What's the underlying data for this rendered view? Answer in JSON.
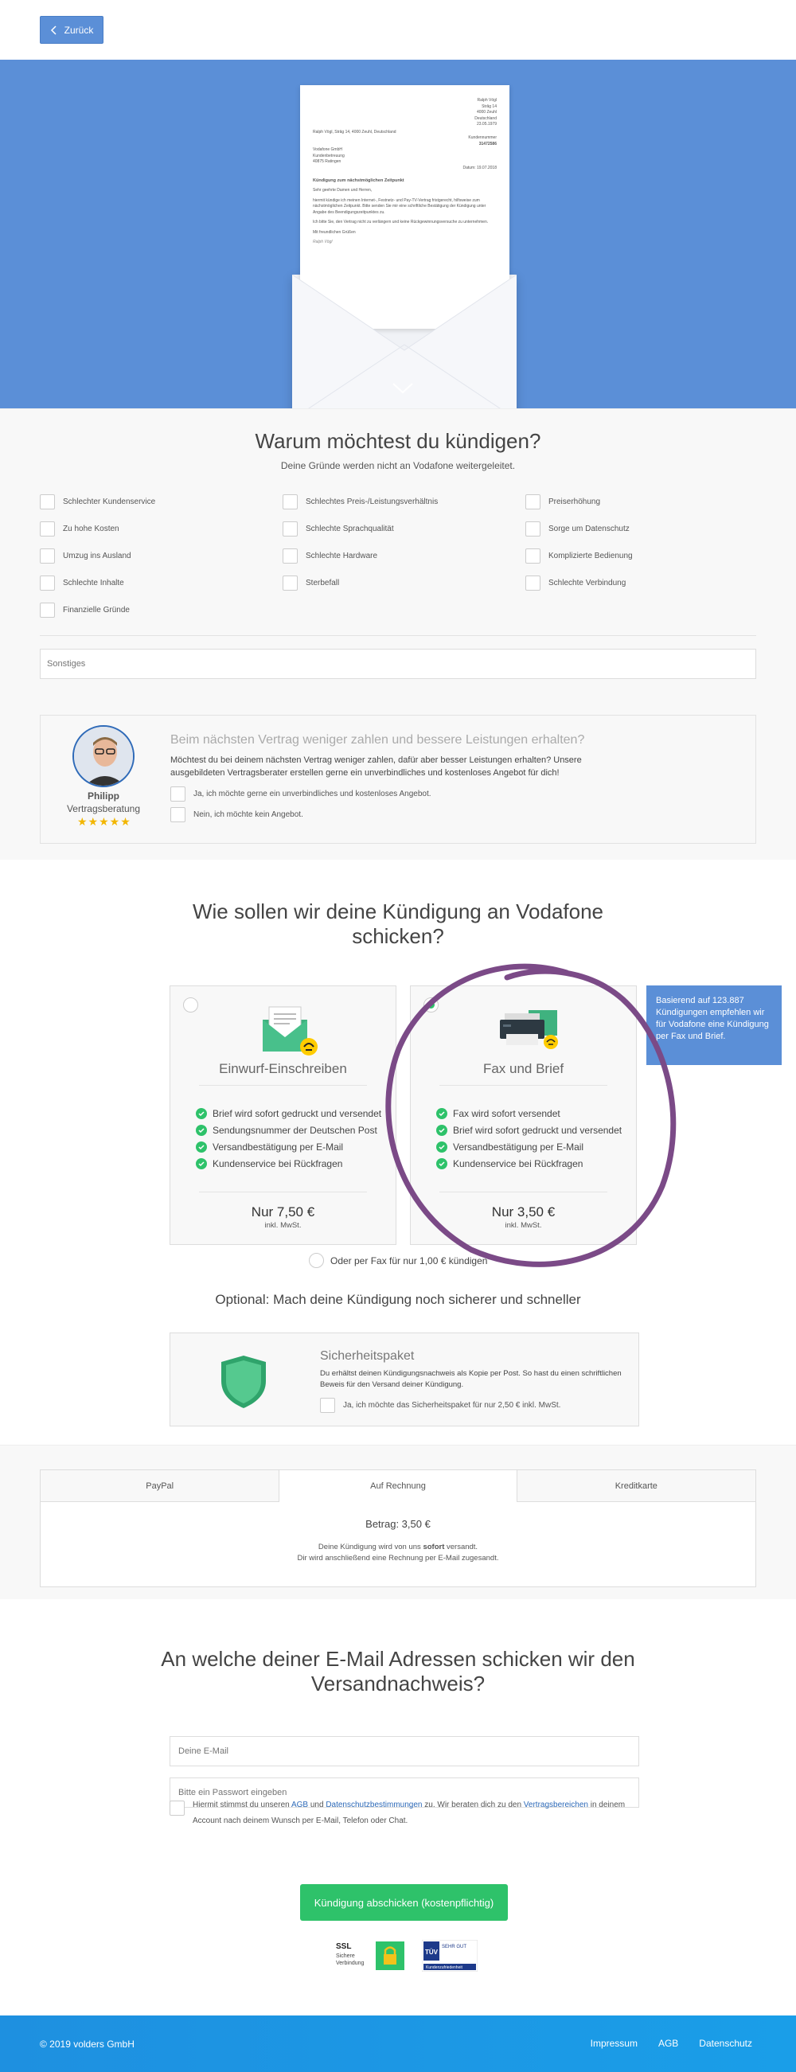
{
  "topbar": {
    "back_label": "Zurück"
  },
  "letter": {
    "sender_address": [
      "Ralph Vögl",
      "Strâg 14",
      "4000 Zeuhl",
      "Deutschland"
    ],
    "sender_line": "Ralph Vögl, Strâg 14, 4000 Zeuhl, Deutschland",
    "date_label": "23.05.1979",
    "customer_no_label": "Kundennummer",
    "customer_no": "31472586",
    "recipient": [
      "Vodafone GmbH",
      "Kundenbetreuung",
      "40875 Ratingen"
    ],
    "date_line": "Datum: 19.07.2018",
    "subject": "Kündigung zum nächstmöglichen Zeitpunkt",
    "salutation": "Sehr geehrte Damen und Herren,",
    "body1": "hiermit kündige ich meinen Internet-, Festnetz- und Pay-TV-Vertrag fristgerecht, hilfsweise zum nächstmöglichen Zeitpunkt. Bitte senden Sie mir eine schriftliche Bestätigung der Kündigung unter Angabe des Beendigungszeitpunktes zu.",
    "body2": "Ich bitte Sie, den Vertrag nicht zu verlängern und keine Rückgewinnungsversuche zu unternehmen.",
    "closing": "Mit freundlichen Grüßen",
    "signature": "Ralph Vögl"
  },
  "reasons": {
    "title": "Warum möchtest du kündigen?",
    "subtitle": "Deine Gründe werden nicht an Vodafone weitergeleitet.",
    "items": [
      "Schlechter Kundenservice",
      "Schlechtes Preis-/Leistungsverhältnis",
      "Preiserhöhung",
      "Zu hohe Kosten",
      "Schlechte Sprachqualität",
      "Sorge um Datenschutz",
      "Umzug ins Ausland",
      "Schlechte Hardware",
      "Komplizierte Bedienung",
      "Schlechte Inhalte",
      "Sterbefall",
      "Schlechte Verbindung",
      "Finanzielle Gründe"
    ],
    "other_placeholder": "Sonstiges"
  },
  "advisor": {
    "name": "Philipp",
    "role": "Vertragsberatung",
    "stars": "★★★★★",
    "title": "Beim nächsten Vertrag weniger zahlen und bessere Leistungen erhalten?",
    "text": "Möchtest du bei deinem nächsten Vertrag weniger zahlen, dafür aber besser Leistungen erhalten? Unsere ausgebildeten Vertragsberater erstellen gerne ein unverbindliches und kostenloses Angebot für dich!",
    "option_yes": "Ja, ich möchte gerne ein unverbindliches und kostenloses Angebot.",
    "option_no": "Nein, ich möchte kein Angebot."
  },
  "shipping": {
    "title": "Wie sollen wir deine Kündigung an Vodafone schicken?",
    "cards": [
      {
        "name": "Einwurf-Einschreiben",
        "features": [
          "Brief wird sofort gedruckt und versendet",
          "Sendungsnummer der Deutschen Post",
          "Versandbestätigung per E-Mail",
          "Kundenservice bei Rückfragen"
        ],
        "price": "Nur 7,50 €",
        "vat": "inkl. MwSt."
      },
      {
        "name": "Fax und Brief",
        "features": [
          "Fax wird sofort versendet",
          "Brief wird sofort gedruckt und versendet",
          "Versandbestätigung per E-Mail",
          "Kundenservice bei Rückfragen"
        ],
        "price": "Nur 3,50 €",
        "vat": "inkl. MwSt."
      }
    ],
    "tooltip": "Basierend auf 123.887 Kündigungen empfehlen wir für Vodafone eine Kündigung per Fax und Brief.",
    "fax_only": "Oder per Fax für nur 1,00 € kündigen",
    "optional_title": "Optional: Mach deine Kündigung noch sicherer und schneller",
    "security": {
      "title": "Sicherheitspaket",
      "text": "Du erhältst deinen Kündigungsnachweis als Kopie per Post. So hast du einen schriftlichen Beweis für den Versand deiner Kündigung.",
      "option": "Ja, ich möchte das Sicherheitspaket für nur 2,50 € inkl. MwSt."
    }
  },
  "payment": {
    "tabs": [
      "PayPal",
      "Auf Rechnung",
      "Kreditkarte"
    ],
    "amount": "Betrag: 3,50 €",
    "note_pre": "Deine Kündigung wird von uns ",
    "note_bold": "sofort",
    "note_post": " versandt.",
    "note2": "Dir wird anschließend eine Rechnung per E-Mail zugesandt."
  },
  "email": {
    "title": "An welche deiner E-Mail Adressen schicken wir den Versandnachweis?",
    "email_placeholder": "Deine E-Mail",
    "password_placeholder": "Bitte ein Passwort eingeben",
    "consent_1": "Hiermit stimmst du unseren ",
    "consent_agb": "AGB",
    "consent_2": " und ",
    "consent_privacy": "Datenschutzbestimmungen",
    "consent_3": " zu. Wir beraten dich zu den ",
    "consent_areas": "Vertragsbereichen",
    "consent_4": " in deinem Account nach deinem Wunsch per E-Mail, Telefon oder Chat.",
    "submit": "Kündigung abschicken (kostenpflichtig)",
    "ssl_title": "SSL",
    "ssl_sub1": "Sichere",
    "ssl_sub2": "Verbindung",
    "tuv_grade": "SEHR GUT",
    "tuv_sub": "Kundenzufriedenheit"
  },
  "footer": {
    "copyright": "© 2019 volders GmbH",
    "links": [
      "Impressum",
      "AGB",
      "Datenschutz"
    ]
  },
  "colors": {
    "brand_blue": "#5b8fd7",
    "success_green": "#2ec26a",
    "annotation_purple": "#7b4a87",
    "footer_blue": "#1e90e0"
  }
}
